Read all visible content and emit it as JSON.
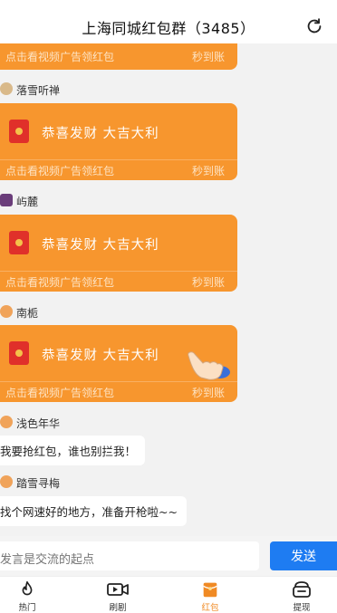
{
  "header": {
    "title": "上海同城红包群（3485）"
  },
  "partial_card": {
    "hint": "点击看视频广告领红包",
    "seconds_label": "秒到账"
  },
  "messages": [
    {
      "sender": "落雪听禅",
      "type": "red_packet",
      "greeting": "恭喜发财 大吉大利",
      "hint": "点击看视频广告领红包",
      "seconds_label": "秒到账"
    },
    {
      "sender": "屿麓",
      "type": "red_packet",
      "greeting": "恭喜发财 大吉大利",
      "hint": "点击看视频广告领红包",
      "seconds_label": "秒到账"
    },
    {
      "sender": "南栀",
      "type": "red_packet",
      "greeting": "恭喜发财 大吉大利",
      "hint": "点击看视频广告领红包",
      "seconds_label": "秒到账"
    },
    {
      "sender": "浅色年华",
      "type": "text",
      "text": "我要抢红包，谁也别拦我！"
    },
    {
      "sender": "踏雪寻梅",
      "type": "text",
      "text": "找个网速好的地方，准备开枪啦~~"
    }
  ],
  "input": {
    "placeholder": "发言是交流的起点",
    "send_label": "发送"
  },
  "tabs": [
    {
      "label": "热门",
      "icon": "fire-icon"
    },
    {
      "label": "刷剧",
      "icon": "video-icon"
    },
    {
      "label": "红包",
      "icon": "red-packet-icon",
      "active": true
    },
    {
      "label": "提现",
      "icon": "wallet-icon"
    }
  ],
  "colors": {
    "card": "#f7962e",
    "accent": "#f08a24",
    "send": "#1e7cf2"
  }
}
